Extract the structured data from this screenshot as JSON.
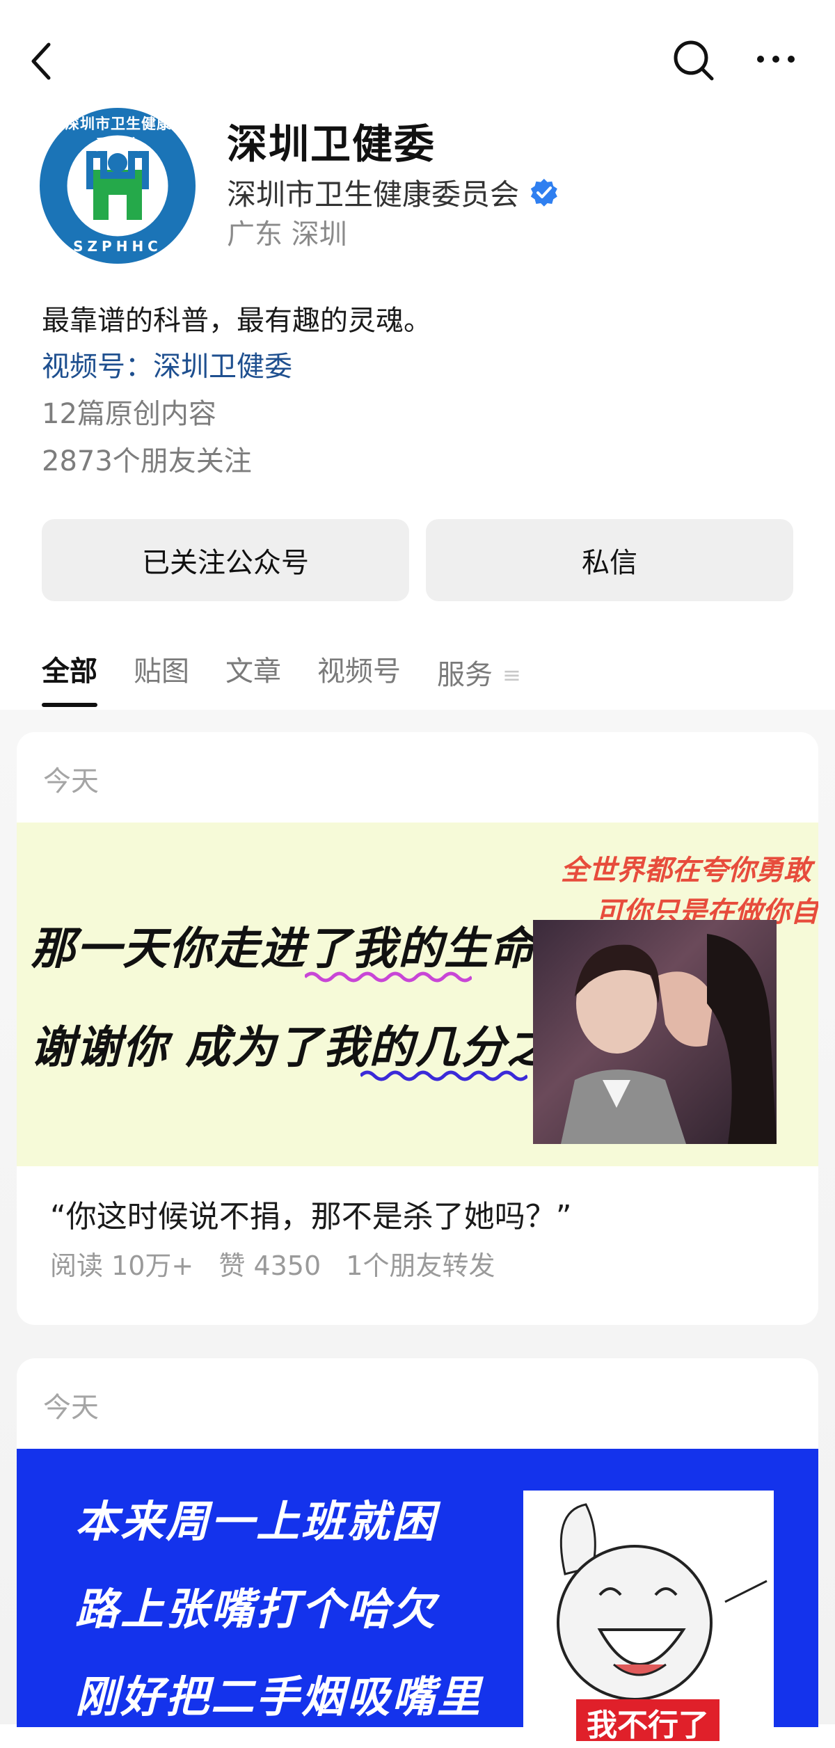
{
  "nav": {
    "back_icon": "chevron-left-icon",
    "search_icon": "search-icon",
    "more_icon": "more-dots-icon"
  },
  "profile": {
    "logo_ring_text": "深圳市卫生健康委员会",
    "logo_inner_text": "SZPHHC",
    "name": "深圳卫健委",
    "org": "深圳市卫生健康委员会",
    "verified_icon": "verified-badge-icon",
    "verified_color": "#2f7ff0",
    "location": "广东 深圳",
    "bio": "最靠谱的科普，最有趣的灵魂。",
    "channel": "视频号：深圳卫健委",
    "original_count": "12篇原创内容",
    "friends_follow": "2873个朋友关注"
  },
  "actions": {
    "follow_label": "已关注公众号",
    "message_label": "私信"
  },
  "tabs": [
    {
      "label": "全部",
      "active": true
    },
    {
      "label": "贴图",
      "active": false
    },
    {
      "label": "文章",
      "active": false
    },
    {
      "label": "视频号",
      "active": false
    },
    {
      "label": "服务",
      "active": false
    }
  ],
  "posts": [
    {
      "date": "今天",
      "banner": {
        "line1": "那一天你走进了我的生命",
        "line2": "谢谢你 成为了我的几分之几",
        "caption1": "全世界都在夸你勇敢",
        "caption2": "可你只是在做你自己"
      },
      "title": "“你这时候说不捐，那不是杀了她吗？”",
      "reads": "阅读 10万+",
      "likes": "赞 4350",
      "shares": "1个朋友转发"
    },
    {
      "date": "今天",
      "banner": {
        "line1": "本来周一上班就困",
        "line2": "路上张嘴打个哈欠",
        "line3": "刚好把二手烟吸嘴里",
        "sticker_text": "我不行了"
      }
    }
  ]
}
